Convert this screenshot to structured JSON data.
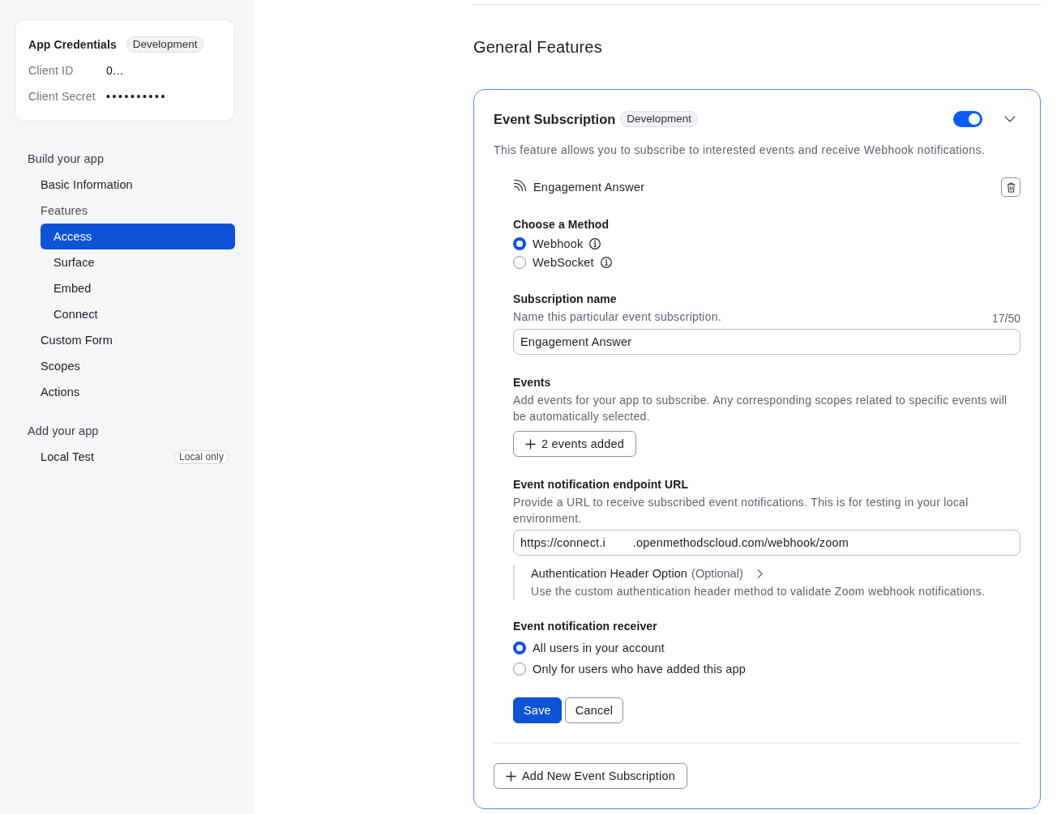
{
  "sidebar": {
    "credentials": {
      "title": "App Credentials",
      "badge": "Development",
      "fields": [
        {
          "label": "Client ID",
          "value": "0..."
        },
        {
          "label": "Client Secret",
          "value": "••••••••••"
        }
      ]
    },
    "sections": [
      {
        "heading": "Build your app",
        "items": [
          {
            "label": "Basic Information",
            "selected": false
          },
          {
            "label": "Features",
            "selected": false,
            "children": [
              {
                "label": "Access",
                "selected": true
              },
              {
                "label": "Surface",
                "selected": false
              },
              {
                "label": "Embed",
                "selected": false
              },
              {
                "label": "Connect",
                "selected": false
              }
            ]
          },
          {
            "label": "Custom Form",
            "selected": false
          },
          {
            "label": "Scopes",
            "selected": false
          },
          {
            "label": "Actions",
            "selected": false
          }
        ]
      },
      {
        "heading": "Add your app",
        "items": [
          {
            "label": "Local Test",
            "selected": false,
            "badge": "Local only"
          }
        ]
      }
    ]
  },
  "page_title": "General Features",
  "feature_card": {
    "title": "Event Subscription",
    "badge": "Development",
    "enabled": true,
    "description": "This feature allows you to subscribe to interested events and receive Webhook notifications.",
    "subscriptions": [
      {
        "name": "Engagement Answer",
        "method": {
          "label": "Choose a Method",
          "options": [
            {
              "label": "Webhook",
              "selected": true,
              "info": true
            },
            {
              "label": "WebSocket",
              "selected": false,
              "info": true
            }
          ]
        },
        "name_field": {
          "label": "Subscription name",
          "hint": "Name this particular event subscription.",
          "counter": "17/50",
          "value": "Engagement Answer"
        },
        "events": {
          "label": "Events",
          "hint": "Add events for your app to subscribe. Any corresponding scopes related to specific events will be automatically selected.",
          "button": "2 events added"
        },
        "endpoint": {
          "label": "Event notification endpoint URL",
          "hint": "Provide a URL to receive subscribed event notifications. This is for testing in your local environment.",
          "value": "https://connect.i        .openmethodscloud.com/webhook/zoom"
        },
        "auth_header": {
          "title": "Authentication Header Option",
          "optional": "(Optional)",
          "description": "Use the custom authentication header method to validate Zoom webhook notifications."
        },
        "receiver": {
          "label": "Event notification receiver",
          "options": [
            {
              "label": "All users in your account",
              "selected": true
            },
            {
              "label": "Only for users who have added this app",
              "selected": false
            }
          ]
        },
        "buttons": [
          {
            "label": "Save",
            "kind": "primary"
          },
          {
            "label": "Cancel",
            "kind": "secondary"
          }
        ]
      }
    ],
    "add_button": "Add New Event Subscription"
  }
}
